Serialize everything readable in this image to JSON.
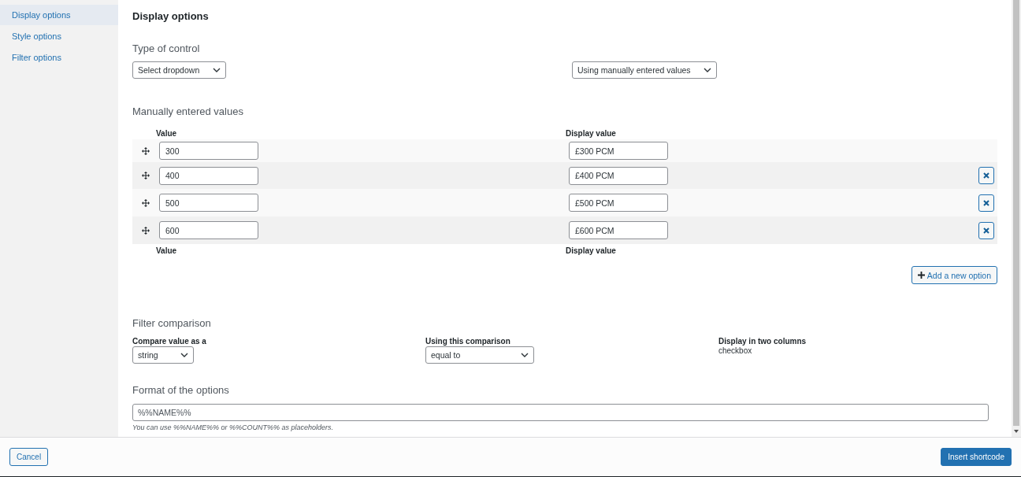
{
  "sidebar": {
    "items": [
      {
        "label": "Display options",
        "selected": true
      },
      {
        "label": "Style options",
        "selected": false
      },
      {
        "label": "Filter options",
        "selected": false
      }
    ]
  },
  "title": "Display options",
  "type_of_control": {
    "heading": "Type of control",
    "control_select": "Select dropdown",
    "source_select": "Using manually entered values"
  },
  "manual_values": {
    "heading": "Manually entered values",
    "columns": [
      "Value",
      "Display value"
    ],
    "rows": [
      {
        "value": "300",
        "display": "£300 PCM",
        "removable": false
      },
      {
        "value": "400",
        "display": "£400 PCM",
        "removable": true
      },
      {
        "value": "500",
        "display": "£500 PCM",
        "removable": true
      },
      {
        "value": "600",
        "display": "£600 PCM",
        "removable": true
      }
    ],
    "footer_columns": [
      "Value",
      "Display value"
    ],
    "add_button": "Add a new option"
  },
  "filter_comparison": {
    "heading": "Filter comparison",
    "compare_label": "Compare value as a",
    "compare_select": "string",
    "using_label": "Using this comparison",
    "using_select": "equal to",
    "two_columns_label": "Display in two columns",
    "two_columns_value": "checkbox"
  },
  "format": {
    "heading": "Format of the options",
    "placeholder": "%%NAME%%",
    "hint": "You can use %%NAME%% or %%COUNT%% as placeholders."
  },
  "footer": {
    "cancel": "Cancel",
    "insert": "Insert shortcode"
  }
}
